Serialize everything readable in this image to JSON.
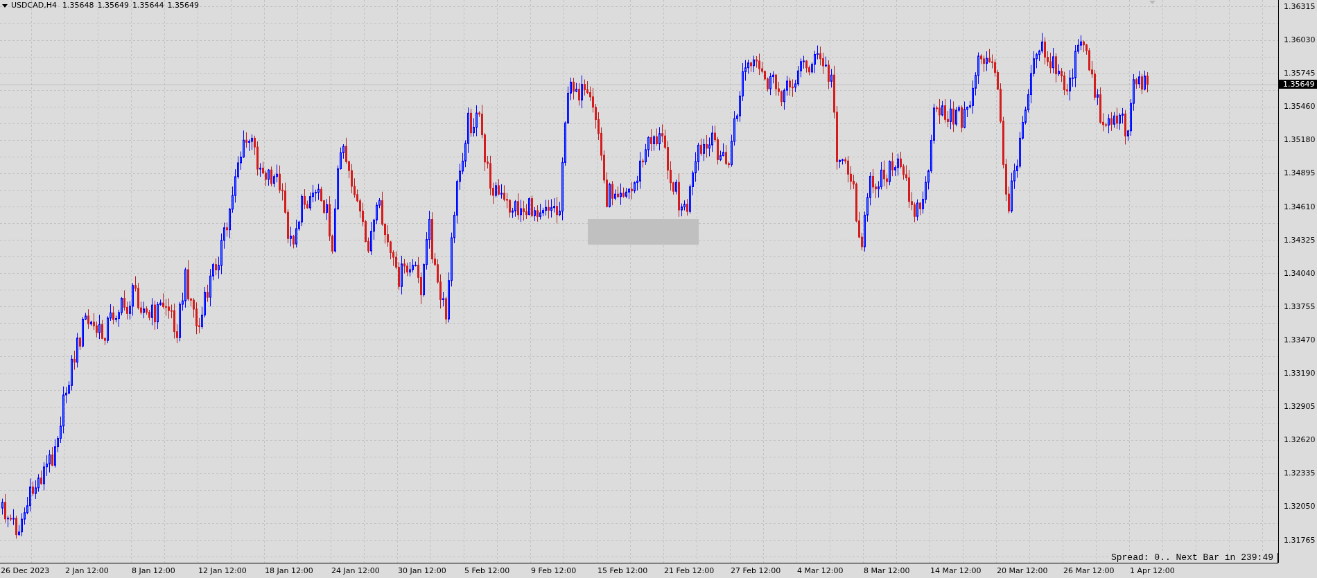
{
  "symbol_bar": {
    "symbol": "USDCAD,H4",
    "open": "1.35648",
    "high": "1.35649",
    "low": "1.35644",
    "close": "1.35649"
  },
  "price_axis": {
    "labels": [
      "1.36315",
      "1.36030",
      "1.35745",
      "1.35460",
      "1.35180",
      "1.34895",
      "1.34610",
      "1.34325",
      "1.34040",
      "1.33755",
      "1.33470",
      "1.33190",
      "1.32905",
      "1.32620",
      "1.32335",
      "1.32050",
      "1.31765"
    ],
    "current_price": "1.35649"
  },
  "time_axis": {
    "labels": [
      "26 Dec 2023",
      "2 Jan 12:00",
      "8 Jan 12:00",
      "12 Jan 12:00",
      "18 Jan 12:00",
      "24 Jan 12:00",
      "30 Jan 12:00",
      "5 Feb 12:00",
      "9 Feb 12:00",
      "15 Feb 12:00",
      "21 Feb 12:00",
      "27 Feb 12:00",
      "4 Mar 12:00",
      "8 Mar 12:00",
      "14 Mar 12:00",
      "20 Mar 12:00",
      "26 Mar 12:00",
      "1 Apr 12:00"
    ]
  },
  "status": {
    "text": "Spread: 0.. Next Bar in 239:49"
  }
}
